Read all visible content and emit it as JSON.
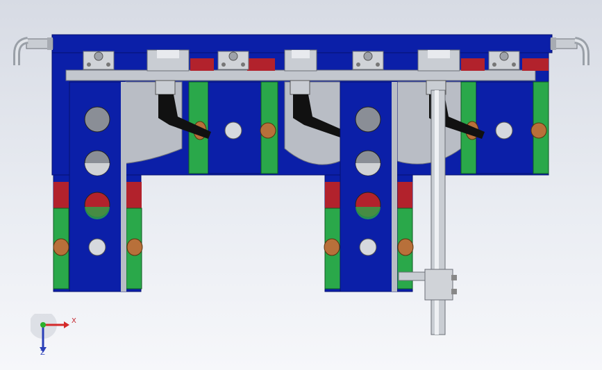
{
  "viewport": {
    "background_top": "#d7dbe4",
    "background_bottom": "#f6f7fa"
  },
  "model": {
    "colors": {
      "frame_blue": "#0b1fa8",
      "frame_dark": "#0a157a",
      "rail_grey": "#b8bcc4",
      "bracket_red": "#b2222c",
      "plate_green": "#2aa84a",
      "hole_grey": "#8a8e96",
      "ball": "#c8ccd2",
      "tab_bronze": "#b8703a",
      "clamp_black": "#111111"
    },
    "parts": {
      "left_pipe_icon": "pipe-elbow-icon",
      "right_pipe_icon": "pipe-elbow-icon",
      "clamp_icon": "toggle-clamp-icon",
      "shaft_icon": "vertical-shaft-icon"
    }
  },
  "triad": {
    "x_label": "X",
    "z_label": "Z",
    "x_color": "#d42a2a",
    "z_color": "#2a3fb8",
    "y_color": "#2bb02b"
  }
}
